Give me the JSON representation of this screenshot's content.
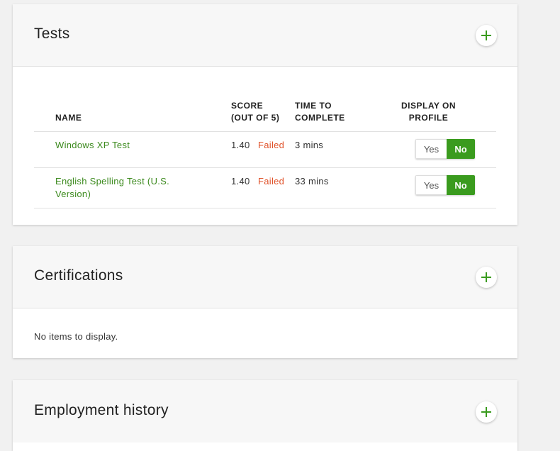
{
  "tests": {
    "title": "Tests",
    "headers": {
      "name": "NAME",
      "score_line1": "SCORE",
      "score_line2": "(OUT OF 5)",
      "time_line1": "TIME TO",
      "time_line2": "COMPLETE",
      "display_line1": "DISPLAY ON",
      "display_line2": "PROFILE"
    },
    "rows": [
      {
        "name_line1": "Windows XP Test",
        "name_line2": "",
        "score": "1.40",
        "status": "Failed",
        "time": "3 mins",
        "yes_label": "Yes",
        "no_label": "No",
        "selected": "No"
      },
      {
        "name_line1": "English Spelling Test (U.S.",
        "name_line2": "Version)",
        "score": "1.40",
        "status": "Failed",
        "time": "33 mins",
        "yes_label": "Yes",
        "no_label": "No",
        "selected": "No"
      }
    ]
  },
  "certifications": {
    "title": "Certifications",
    "empty_message": "No items to display."
  },
  "employment": {
    "title": "Employment history"
  },
  "colors": {
    "accent_green": "#3a9b1e",
    "link_green": "#3c8a1e",
    "failed_orange": "#e0522a"
  },
  "icons": {
    "add": "plus-icon"
  }
}
